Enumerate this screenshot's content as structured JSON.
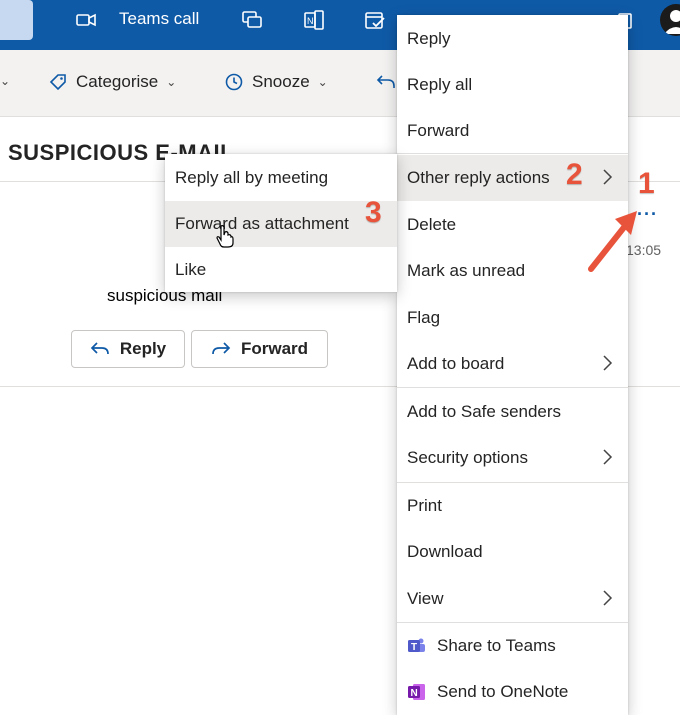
{
  "header": {
    "teams_call_label": "Teams call",
    "icons": [
      "video-icon",
      "chat-icon",
      "outlook-icon",
      "calendar-icon",
      "app-icon",
      "avatar"
    ]
  },
  "ribbon": {
    "categorise_label": "Categorise",
    "snooze_label": "Snooze"
  },
  "message": {
    "subject": "SUSPICIOUS E-MAIL",
    "body": "suspicious mail",
    "time": "13:05",
    "reply_label": "Reply",
    "forward_label": "Forward"
  },
  "menu": {
    "items": [
      {
        "label": "Reply"
      },
      {
        "label": "Reply all"
      },
      {
        "label": "Forward"
      },
      {
        "label": "Other reply actions",
        "submenu": true,
        "active": true
      },
      {
        "label": "Delete"
      },
      {
        "label": "Mark as unread"
      },
      {
        "label": "Flag"
      },
      {
        "label": "Add to board",
        "submenu": true
      },
      {
        "label": "Add to Safe senders"
      },
      {
        "label": "Security options",
        "submenu": true
      },
      {
        "label": "Print"
      },
      {
        "label": "Download"
      },
      {
        "label": "View",
        "submenu": true
      },
      {
        "label": "Share to Teams"
      },
      {
        "label": "Send to OneNote"
      }
    ]
  },
  "submenu": {
    "items": [
      {
        "label": "Reply all by meeting"
      },
      {
        "label": "Forward as attachment",
        "active": true
      },
      {
        "label": "Like"
      }
    ]
  },
  "annotations": {
    "step1": "1",
    "step2": "2",
    "step3": "3"
  },
  "colors": {
    "header_bg": "#0f5aa7",
    "annotation": "#e8533b",
    "hover_bg": "#edebe9"
  }
}
